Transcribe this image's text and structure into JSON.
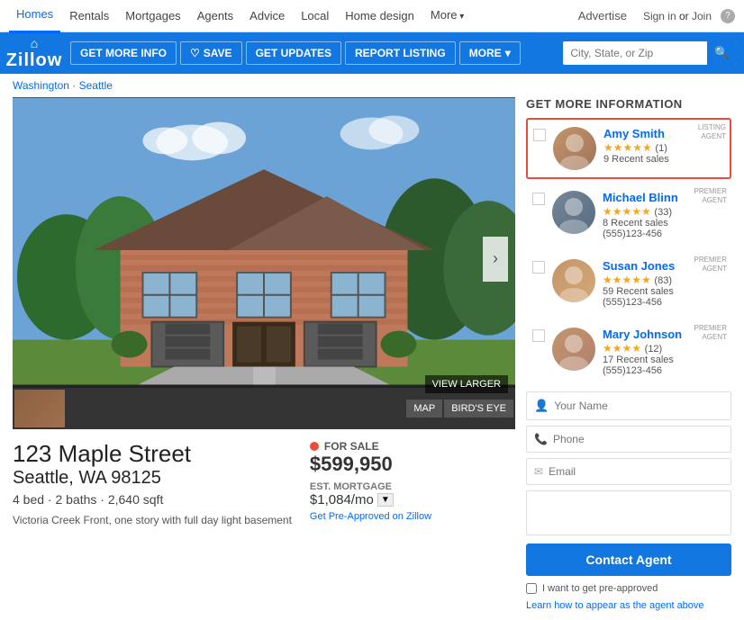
{
  "topnav": {
    "links": [
      {
        "label": "Homes",
        "active": true
      },
      {
        "label": "Rentals",
        "active": false
      },
      {
        "label": "Mortgages",
        "active": false
      },
      {
        "label": "Agents",
        "active": false
      },
      {
        "label": "Advice",
        "active": false
      },
      {
        "label": "Local",
        "active": false
      },
      {
        "label": "Home design",
        "active": false
      },
      {
        "label": "More",
        "active": false
      }
    ],
    "advertise": "Advertise",
    "sign_in": "Sign in",
    "or": " or ",
    "join": "Join",
    "help": "?"
  },
  "logobar": {
    "logo_text": "Zillow",
    "get_more_info": "GET MORE INFO",
    "save": "SAVE",
    "get_updates": "GET UPDATES",
    "report_listing": "REPORT LISTING",
    "more": "MORE",
    "search_placeholder": "City, State, or Zip"
  },
  "breadcrumb": {
    "state": "Washington",
    "separator": " · ",
    "city": "Seattle"
  },
  "image": {
    "view_larger": "VIEW LARGER",
    "map_btn": "MAP",
    "birds_eye_btn": "BIRD'S EYE",
    "nav_arrow": "›"
  },
  "property": {
    "address_line1": "123 Maple Street",
    "address_line2": "Seattle, WA 98125",
    "beds": "4 bed · 2 baths · 2,640 sqft",
    "for_sale_label": "FOR SALE",
    "price": "$599,950",
    "est_mortgage_label": "EST. MORTGAGE",
    "mortgage_amount": "$1,084/mo",
    "calc_icon": "▼",
    "pre_approve_link": "Get Pre-Approved on Zillow",
    "description": "Victoria Creek Front, one story with full day light basement"
  },
  "sidebar": {
    "title": "GET MORE INFORMATION",
    "agents": [
      {
        "name": "Amy Smith",
        "stars": "★★★★★",
        "rating": "(1)",
        "sales": "9 Recent sales",
        "phone": "",
        "badge_line1": "LISTING",
        "badge_line2": "AGENT",
        "highlighted": true,
        "avatar_class": "avatar-amy"
      },
      {
        "name": "Michael Blinn",
        "stars": "★★★★★",
        "rating": "(33)",
        "sales": "8 Recent sales",
        "phone": "(555)123-456",
        "badge_line1": "PREMIER",
        "badge_line2": "AGENT",
        "highlighted": false,
        "avatar_class": "avatar-michael"
      },
      {
        "name": "Susan Jones",
        "stars": "★★★★★",
        "rating": "(83)",
        "sales": "59 Recent sales",
        "phone": "(555)123-456",
        "badge_line1": "PREMIER",
        "badge_line2": "AGENT",
        "highlighted": false,
        "avatar_class": "avatar-susan"
      },
      {
        "name": "Mary Johnson",
        "stars": "★★★★",
        "rating": "(12)",
        "sales": "17 Recent sales",
        "phone": "(555)123-456",
        "badge_line1": "PREMIER",
        "badge_line2": "AGENT",
        "highlighted": false,
        "avatar_class": "avatar-mary"
      }
    ],
    "form": {
      "name_placeholder": "Your Name",
      "phone_placeholder": "Phone",
      "email_placeholder": "Email",
      "contact_btn": "Contact Agent",
      "pre_approve_label": "I want to get pre-approved",
      "learn_link": "Learn how to appear as the agent above"
    }
  }
}
